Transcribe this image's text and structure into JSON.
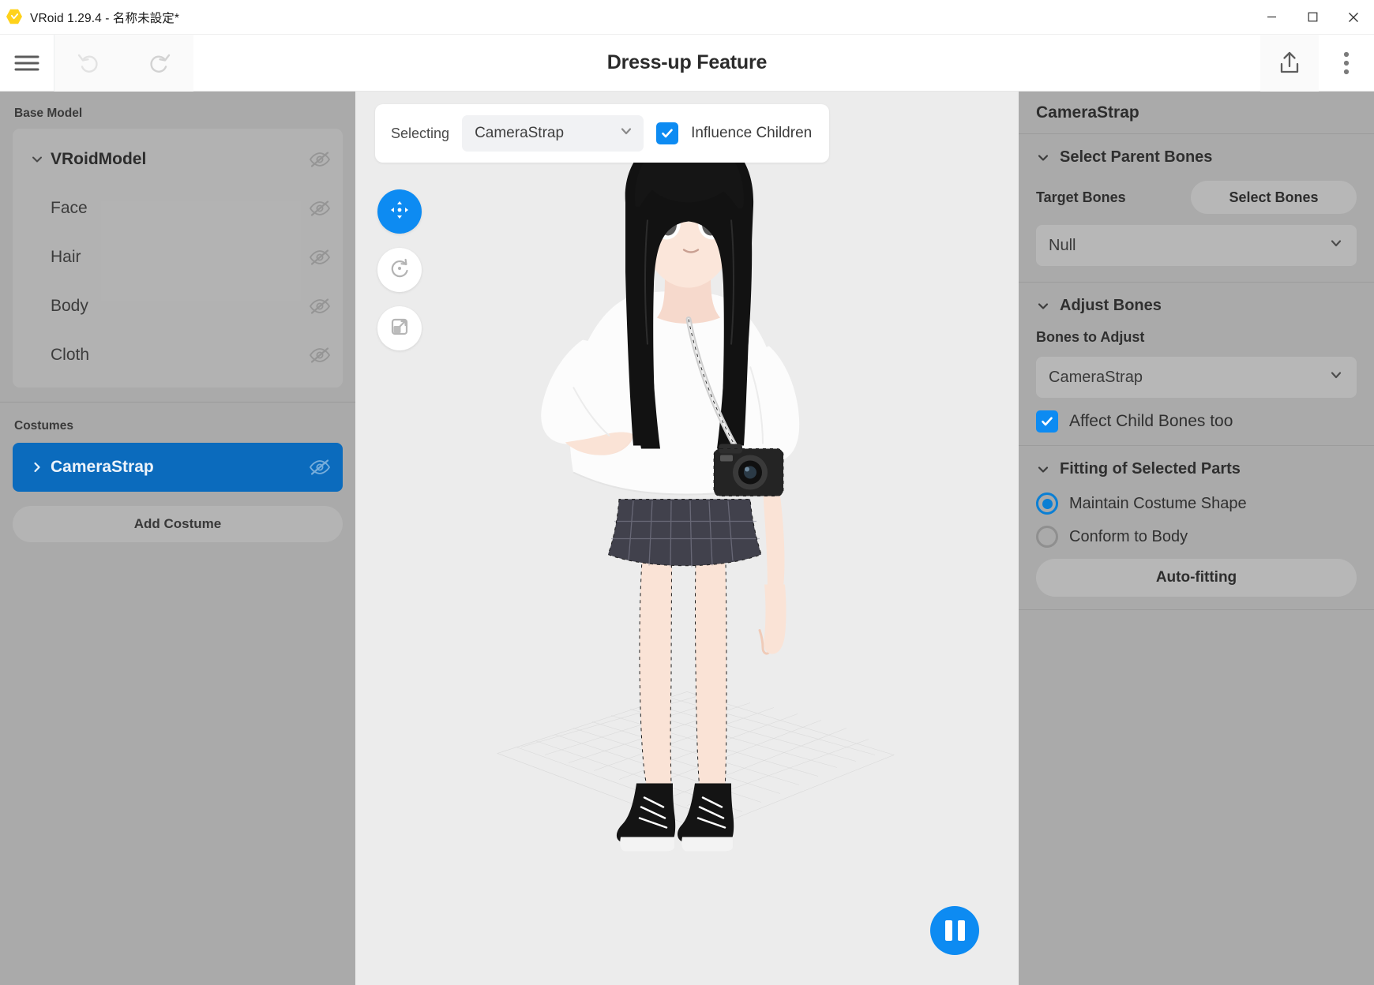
{
  "window": {
    "title": "VRoid 1.29.4 - 名称未設定*",
    "logo_icon": "vroid-hexagon-icon",
    "minimize_icon": "minimize-icon",
    "maximize_icon": "maximize-icon",
    "close_icon": "close-icon"
  },
  "toolbar": {
    "menu_icon": "hamburger-menu-icon",
    "undo_icon": "undo-icon",
    "redo_icon": "redo-icon",
    "title": "Dress-up Feature",
    "export_icon": "export-upload-icon",
    "more_icon": "more-vertical-icon"
  },
  "sidebar_left": {
    "base_model_title": "Base Model",
    "tree": [
      {
        "label": "VRoidModel",
        "root": true,
        "chevron": "chevron-down-icon",
        "visibility_icon": "eye-off-icon"
      },
      {
        "label": "Face",
        "root": false,
        "visibility_icon": "eye-off-icon"
      },
      {
        "label": "Hair",
        "root": false,
        "visibility_icon": "eye-off-icon"
      },
      {
        "label": "Body",
        "root": false,
        "visibility_icon": "eye-off-icon"
      },
      {
        "label": "Cloth",
        "root": false,
        "visibility_icon": "eye-off-icon"
      }
    ],
    "costumes_title": "Costumes",
    "costume_selected": {
      "label": "CameraStrap",
      "chevron": "chevron-right-icon",
      "visibility_icon": "eye-off-icon"
    },
    "add_costume_label": "Add Costume"
  },
  "viewport": {
    "selecting_label": "Selecting",
    "selecting_value": "CameraStrap",
    "selecting_chevron": "chevron-down-icon",
    "influence_children_label": "Influence Children",
    "influence_children_checked": true,
    "tools": [
      {
        "name": "move-tool",
        "icon": "move-arrows-icon",
        "active": true
      },
      {
        "name": "rotate-tool",
        "icon": "rotate-icon",
        "active": false
      },
      {
        "name": "scale-tool",
        "icon": "scale-icon",
        "active": false
      }
    ],
    "pause_icon": "pause-icon"
  },
  "sidebar_right": {
    "header": "CameraStrap",
    "select_parent_bones": {
      "title": "Select Parent Bones",
      "chevron": "chevron-down-icon",
      "target_bones_label": "Target Bones",
      "select_bones_button": "Select Bones",
      "dropdown_value": "Null",
      "dropdown_chevron": "chevron-down-icon"
    },
    "adjust_bones": {
      "title": "Adjust Bones",
      "chevron": "chevron-down-icon",
      "bones_to_adjust_label": "Bones to Adjust",
      "dropdown_value": "CameraStrap",
      "dropdown_chevron": "chevron-down-icon",
      "affect_child_label": "Affect Child Bones too",
      "affect_child_checked": true
    },
    "fitting": {
      "title": "Fitting of Selected Parts",
      "chevron": "chevron-down-icon",
      "option_maintain": "Maintain Costume Shape",
      "option_conform": "Conform to Body",
      "selected_option": "Maintain Costume Shape",
      "auto_fitting_button": "Auto-fitting"
    }
  },
  "colors": {
    "accent_blue": "#0d8bf2",
    "selected_blue": "#0b6bbd",
    "panel_gray": "#aaaaaa",
    "viewport_gray": "#ececec"
  }
}
